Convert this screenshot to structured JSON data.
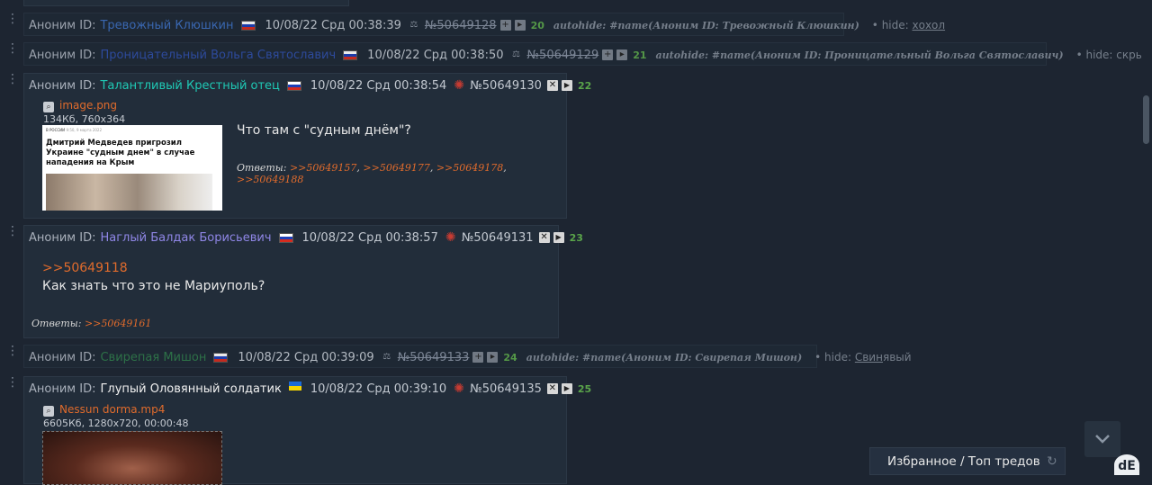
{
  "posts": [
    {
      "label": "Аноним ID:",
      "name": "Тревожный Клюшкин",
      "name_color": "#3d6fbf",
      "date": "10/08/22 Срд 00:38:39",
      "number": "№50649128",
      "pos": "20",
      "autohide": "autohide: #name(Аноним ID: Тревожный Клюшкин)",
      "hide_prefix": "• hide:",
      "hide_value": "хохол"
    },
    {
      "label": "Аноним ID:",
      "name": "Проницательный Вольга Святославич",
      "name_color": "#2f4fa8",
      "date": "10/08/22 Срд 00:38:50",
      "number": "№50649129",
      "pos": "21",
      "autohide": "autohide: #name(Аноним ID: Проницательный Вольга Святославич)",
      "hide_prefix": "• hide:",
      "hide_value": "скрыт по ID"
    },
    {
      "label": "Аноним ID:",
      "name": "Талантливый Крестный отец",
      "name_color": "#1fc9b5",
      "date": "10/08/22 Срд 00:38:54",
      "number": "№50649130",
      "pos": "22",
      "file_name": "image.png",
      "file_meta": "134Кб, 760x364",
      "thumb_rubric": "В РОССИИ",
      "thumb_date": "9:50, 9 марта 2022",
      "thumb_headline": "Дмитрий Медведев пригрозил Украине \"судным днем\" в случае нападения на Крым",
      "text": "Что там с \"судным днём\"?",
      "replies_label": "Ответы:",
      "replies": [
        ">>50649157",
        ">>50649177",
        ">>50649178",
        ">>50649188"
      ]
    },
    {
      "label": "Аноним ID:",
      "name": "Наглый Балдак Борисьевич",
      "name_color": "#8f86e6",
      "date": "10/08/22 Срд 00:38:57",
      "number": "№50649131",
      "pos": "23",
      "quote": ">>50649118",
      "text": "Как знать что это не Мариуполь?",
      "replies_label": "Ответы:",
      "replies": [
        ">>50649161"
      ]
    },
    {
      "label": "Аноним ID:",
      "name": "Свирепая Мишон",
      "name_color": "#2f7a4a",
      "date": "10/08/22 Срд 00:39:09",
      "number": "№50649133",
      "pos": "24",
      "autohide": "autohide: #name(Аноним ID: Свирепая Мишон)",
      "hide_prefix": "• hide:",
      "hide_value_u": "Свин",
      "hide_value_rest": "явый"
    },
    {
      "label": "Аноним ID:",
      "name": "Глупый Оловянный солдатик",
      "name_color": "#f0f0f0",
      "date": "10/08/22 Срд 00:39:10",
      "number": "№50649135",
      "pos": "25",
      "file_name": "Nessun dorma.mp4",
      "file_meta": "6605Кб, 1280x720, 00:00:48"
    }
  ],
  "favorites_label": "Избранное / Топ тредов",
  "icons": {
    "post_menu": "dots-icon",
    "hide": "ban-icon",
    "report": "report-icon",
    "add": "plus-icon",
    "delete": "close-icon",
    "expand": "play-icon",
    "magnify": "magnifier-icon",
    "scroll_down": "chevron-down-icon",
    "refresh": "refresh-icon",
    "logo": "dollchan-logo-icon"
  }
}
